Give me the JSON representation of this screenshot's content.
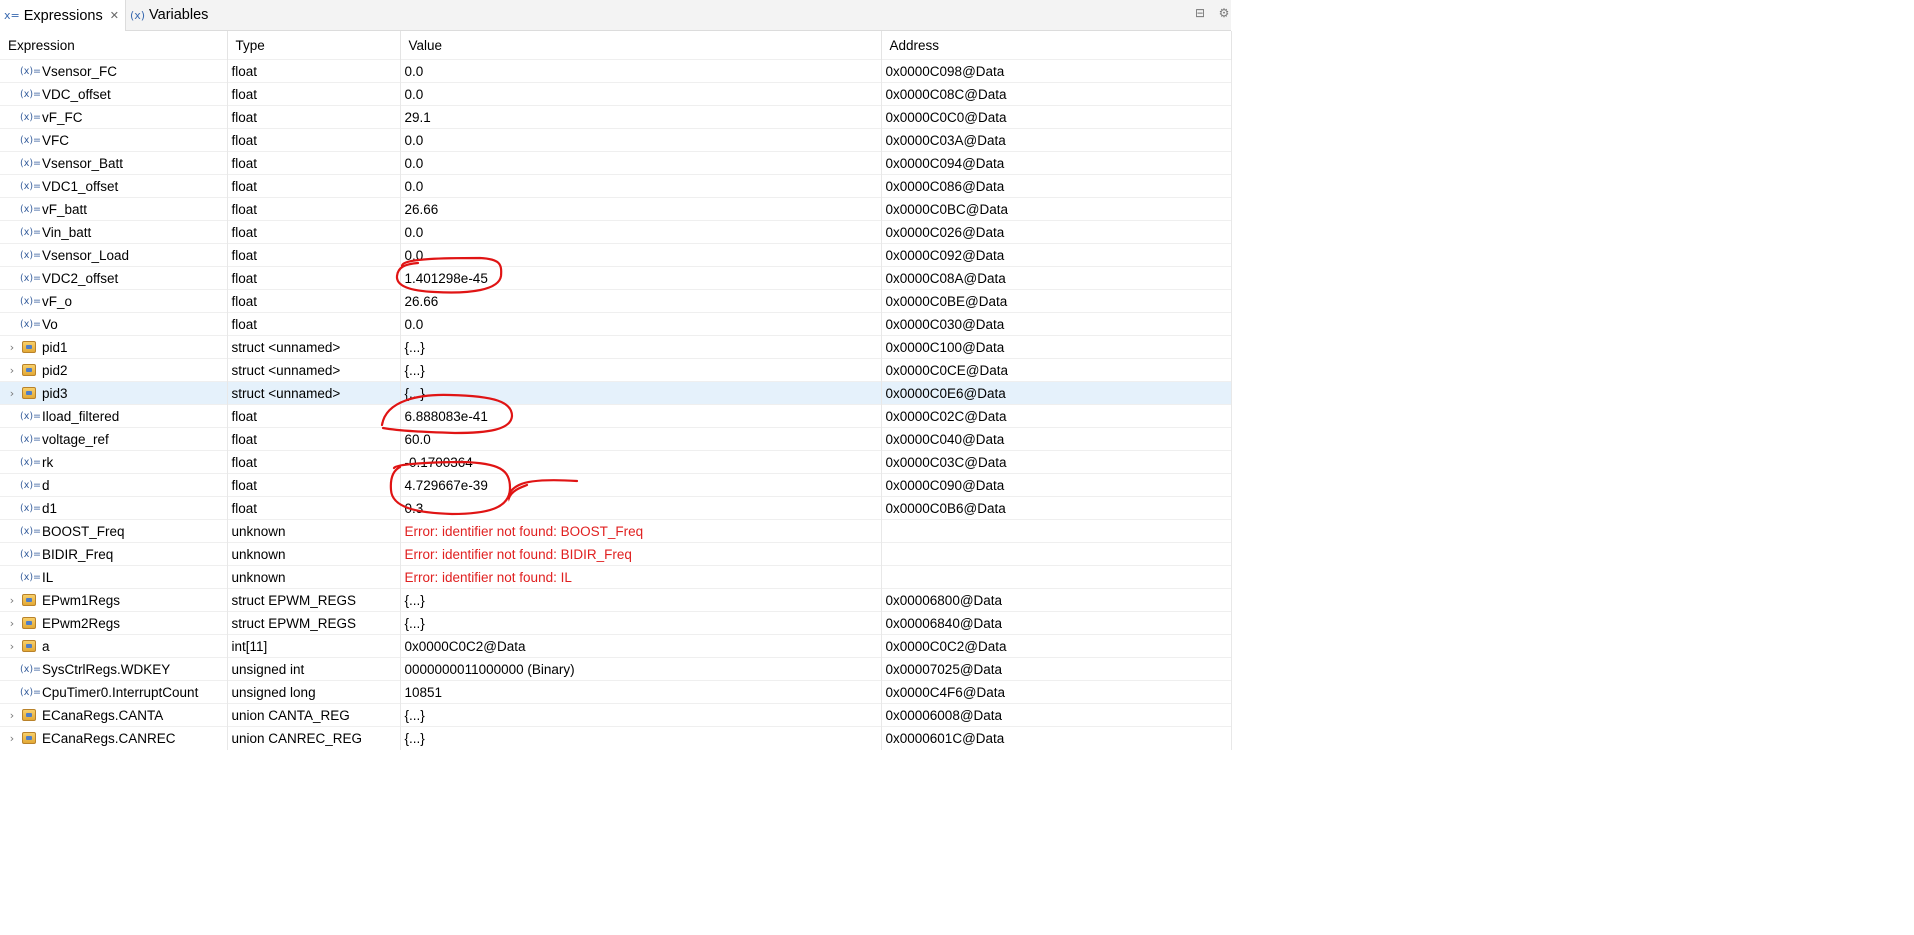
{
  "tabs": [
    {
      "label": "Expressions",
      "active": true,
      "icon": "expressions-icon",
      "closable": true
    },
    {
      "label": "Variables",
      "active": false,
      "icon": "variables-icon",
      "closable": false
    }
  ],
  "columns": [
    "Expression",
    "Type",
    "Value",
    "Address"
  ],
  "rows": [
    {
      "expression": "Vsensor_FC",
      "type": "float",
      "value": "0.0",
      "address": "0x0000C098@Data",
      "kind": "var"
    },
    {
      "expression": "VDC_offset",
      "type": "float",
      "value": "0.0",
      "address": "0x0000C08C@Data",
      "kind": "var"
    },
    {
      "expression": "vF_FC",
      "type": "float",
      "value": "29.1",
      "address": "0x0000C0C0@Data",
      "kind": "var"
    },
    {
      "expression": "VFC",
      "type": "float",
      "value": "0.0",
      "address": "0x0000C03A@Data",
      "kind": "var"
    },
    {
      "expression": "Vsensor_Batt",
      "type": "float",
      "value": "0.0",
      "address": "0x0000C094@Data",
      "kind": "var"
    },
    {
      "expression": "VDC1_offset",
      "type": "float",
      "value": "0.0",
      "address": "0x0000C086@Data",
      "kind": "var"
    },
    {
      "expression": "vF_batt",
      "type": "float",
      "value": "26.66",
      "address": "0x0000C0BC@Data",
      "kind": "var"
    },
    {
      "expression": "Vin_batt",
      "type": "float",
      "value": "0.0",
      "address": "0x0000C026@Data",
      "kind": "var"
    },
    {
      "expression": "Vsensor_Load",
      "type": "float",
      "value": "0.0",
      "address": "0x0000C092@Data",
      "kind": "var"
    },
    {
      "expression": "VDC2_offset",
      "type": "float",
      "value": "1.401298e-45",
      "address": "0x0000C08A@Data",
      "kind": "var"
    },
    {
      "expression": "vF_o",
      "type": "float",
      "value": "26.66",
      "address": "0x0000C0BE@Data",
      "kind": "var"
    },
    {
      "expression": "Vo",
      "type": "float",
      "value": "0.0",
      "address": "0x0000C030@Data",
      "kind": "var"
    },
    {
      "expression": "pid1",
      "type": "struct <unnamed>",
      "value": "{...}",
      "address": "0x0000C100@Data",
      "kind": "struct"
    },
    {
      "expression": "pid2",
      "type": "struct <unnamed>",
      "value": "{...}",
      "address": "0x0000C0CE@Data",
      "kind": "struct"
    },
    {
      "expression": "pid3",
      "type": "struct <unnamed>",
      "value": "{...}",
      "address": "0x0000C0E6@Data",
      "kind": "struct",
      "selected": true
    },
    {
      "expression": "Iload_filtered",
      "type": "float",
      "value": "6.888083e-41",
      "address": "0x0000C02C@Data",
      "kind": "var"
    },
    {
      "expression": "voltage_ref",
      "type": "float",
      "value": "60.0",
      "address": "0x0000C040@Data",
      "kind": "var"
    },
    {
      "expression": "rk",
      "type": "float",
      "value": "-0.1700364",
      "address": "0x0000C03C@Data",
      "kind": "var"
    },
    {
      "expression": "d",
      "type": "float",
      "value": "4.729667e-39",
      "address": "0x0000C090@Data",
      "kind": "var"
    },
    {
      "expression": "d1",
      "type": "float",
      "value": "0.3",
      "address": "0x0000C0B6@Data",
      "kind": "var"
    },
    {
      "expression": "BOOST_Freq",
      "type": "unknown",
      "value": "Error: identifier not found: BOOST_Freq",
      "address": "",
      "kind": "var",
      "error": true
    },
    {
      "expression": "BIDIR_Freq",
      "type": "unknown",
      "value": "Error: identifier not found: BIDIR_Freq",
      "address": "",
      "kind": "var",
      "error": true
    },
    {
      "expression": "IL",
      "type": "unknown",
      "value": "Error: identifier not found: IL",
      "address": "",
      "kind": "var",
      "error": true
    },
    {
      "expression": "EPwm1Regs",
      "type": "struct EPWM_REGS",
      "value": "{...}",
      "address": "0x00006800@Data",
      "kind": "struct"
    },
    {
      "expression": "EPwm2Regs",
      "type": "struct EPWM_REGS",
      "value": "{...}",
      "address": "0x00006840@Data",
      "kind": "struct"
    },
    {
      "expression": "a",
      "type": "int[11]",
      "value": "0x0000C0C2@Data",
      "address": "0x0000C0C2@Data",
      "kind": "struct"
    },
    {
      "expression": "SysCtrlRegs.WDKEY",
      "type": "unsigned int",
      "value": "0000000011000000 (Binary)",
      "address": "0x00007025@Data",
      "kind": "var"
    },
    {
      "expression": "CpuTimer0.InterruptCount",
      "type": "unsigned long",
      "value": "10851",
      "address": "0x0000C4F6@Data",
      "kind": "var"
    },
    {
      "expression": "ECanaRegs.CANTA",
      "type": "union CANTA_REG",
      "value": "{...}",
      "address": "0x00006008@Data",
      "kind": "struct"
    },
    {
      "expression": "ECanaRegs.CANREC",
      "type": "union CANREC_REG",
      "value": "{...}",
      "address": "0x0000601C@Data",
      "kind": "struct"
    }
  ],
  "icons": {
    "variable": "variable-icon",
    "struct": "struct-icon",
    "expander": "chevron-right-icon",
    "toolbar": [
      "collapse-all-icon",
      "settings-icon"
    ]
  },
  "colors": {
    "selected_row": "#e5f1fb",
    "error_text": "#e02020",
    "annotation": "#e01414"
  },
  "annotations": [
    {
      "type": "ellipse",
      "target_row": 9,
      "color": "#e01414"
    },
    {
      "type": "ellipse",
      "target_row": 15,
      "color": "#e01414"
    },
    {
      "type": "ellipse-with-arrow",
      "target_row": 18,
      "color": "#e01414"
    }
  ]
}
